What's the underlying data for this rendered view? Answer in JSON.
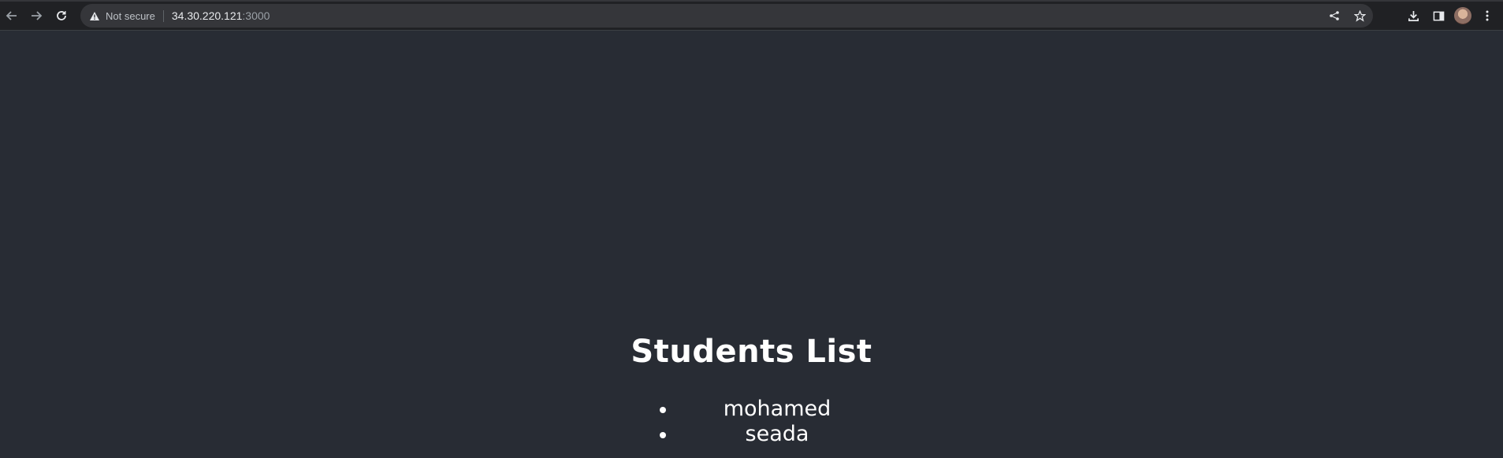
{
  "browser": {
    "security_label": "Not secure",
    "url_host": "34.30.220.121",
    "url_port": ":3000",
    "icons": {
      "back": "back-arrow-icon",
      "forward": "forward-arrow-icon",
      "reload": "reload-icon",
      "warning": "warning-triangle-icon",
      "share": "share-icon",
      "bookmark": "star-icon",
      "download": "download-icon",
      "side_panel": "side-panel-icon",
      "menu": "kebab-menu-icon"
    }
  },
  "page": {
    "title": "Students List",
    "students": [
      {
        "name": "mohamed"
      },
      {
        "name": "seada"
      }
    ],
    "colors": {
      "background": "#282c34",
      "text": "#ffffff"
    }
  }
}
